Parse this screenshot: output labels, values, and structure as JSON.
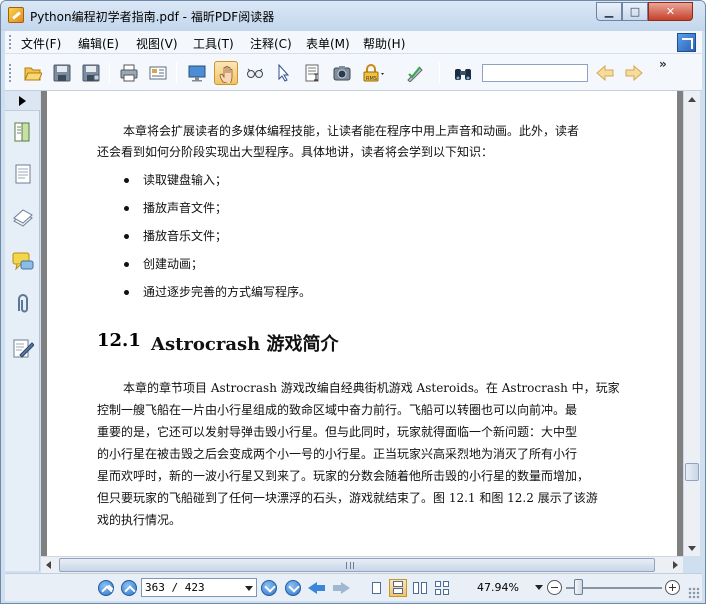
{
  "window": {
    "title": "Python编程初学者指南.pdf - 福昕PDF阅读器"
  },
  "menu": {
    "items": [
      "文件(F)",
      "编辑(E)",
      "视图(V)",
      "工具(T)",
      "注释(C)",
      "表单(M)",
      "帮助(H)"
    ]
  },
  "toolbar": {
    "buttons": [
      {
        "name": "open-icon"
      },
      {
        "name": "save-icon"
      },
      {
        "name": "save-as-icon"
      },
      {
        "name": "print-icon"
      },
      {
        "name": "properties-icon"
      },
      {
        "name": "fullscreen-icon"
      },
      {
        "name": "hand-tool-icon",
        "active": true
      },
      {
        "name": "loupe-icon"
      },
      {
        "name": "select-tool-icon"
      },
      {
        "name": "text-select-icon"
      },
      {
        "name": "snapshot-icon"
      },
      {
        "name": "rms-lock-icon"
      },
      {
        "name": "sign-icon"
      },
      {
        "name": "find-icon"
      },
      {
        "name": "find-previous-icon"
      },
      {
        "name": "find-next-icon"
      }
    ],
    "search_value": ""
  },
  "left_panel": {
    "buttons": [
      "bookmarks-icon",
      "pages-icon",
      "layers-icon",
      "comments-icon",
      "attachments-icon",
      "signature-icon"
    ]
  },
  "document": {
    "intro_line1": "本章将会扩展读者的多媒体编程技能，让读者能在程序中用上声音和动画。此外，读者",
    "intro_line2": "还会看到如何分阶段实现出大型程序。具体地讲，读者将会学到以下知识：",
    "bullets": [
      "读取键盘输入；",
      "播放声音文件；",
      "播放音乐文件；",
      "创建动画；",
      "通过逐步完善的方式编写程序。"
    ],
    "section_number": "12.1",
    "section_title": "Astrocrash 游戏简介",
    "body_lines": [
      "本章的章节项目 Astrocrash 游戏改编自经典街机游戏 Asteroids。在 Astrocrash 中，玩家",
      "控制一艘飞船在一片由小行星组成的致命区域中奋力前行。飞船可以转圈也可以向前冲。最",
      "重要的是，它还可以发射导弹击毁小行星。但与此同时，玩家就得面临一个新问题：大中型",
      "的小行星在被击毁之后会变成两个小一号的小行星。正当玩家兴高采烈地为消灭了所有小行",
      "星而欢呼时，新的一波小行星又到来了。玩家的分数会随着他所击毁的小行星的数量而增加，",
      "但只要玩家的飞船碰到了任何一块漂浮的石头，游戏就结束了。图 12.1 和图 12.2 展示了该游",
      "戏的执行情况。"
    ]
  },
  "statusbar": {
    "page_value": "363 / 423",
    "zoom": "47.94%",
    "zoom_level_fraction": 0.13
  },
  "colors": {
    "titlebar": "#c2d6ec",
    "active_tool": "#f2c46a",
    "doc_background": "#808080"
  }
}
